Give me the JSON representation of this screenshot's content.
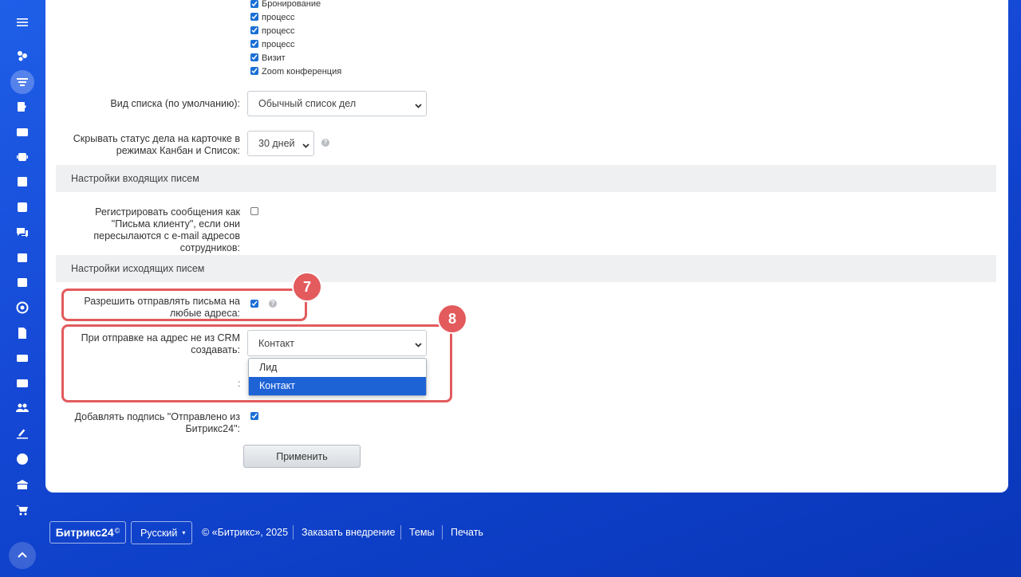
{
  "activity_types": [
    {
      "label": "Бронирование",
      "checked": true
    },
    {
      "label": "процесс",
      "checked": true
    },
    {
      "label": "процесс",
      "checked": true
    },
    {
      "label": "процесс",
      "checked": true
    },
    {
      "label": "Визит",
      "checked": true
    },
    {
      "label": "Zoom конференция",
      "checked": true
    }
  ],
  "list_view": {
    "label": "Вид списка (по умолчанию):",
    "value": "Обычный список дел"
  },
  "hide_status": {
    "label_line1": "Скрывать статус дела на карточке в",
    "label_line2": "режимах Канбан и Список:",
    "value": "30 дней"
  },
  "incoming_section": "Настройки входящих писем",
  "register_messages": {
    "label_line1": "Регистрировать сообщения как",
    "label_line2": "\"Письма клиенту\", если они",
    "label_line3": "пересылаются с e-mail адресов",
    "label_line4": "сотрудников:",
    "checked": false
  },
  "outgoing_section": "Настройки исходящих писем",
  "allow_any": {
    "label_line1": "Разрешить отправлять письма на",
    "label_line2": "любые адреса:",
    "checked": true
  },
  "create_on_send": {
    "label_line1": "При отправке на адрес не из CRM",
    "label_line2": "создавать:",
    "value": "Контакт",
    "options": [
      "Лид",
      "Контакт"
    ],
    "selected_index": 1,
    "stray": ":"
  },
  "add_signature": {
    "label_line1": "Добавлять подпись \"Отправлено из",
    "label_line2": "Битрикс24\":",
    "checked": true
  },
  "apply_label": "Применить",
  "badges": {
    "b7": "7",
    "b8": "8"
  },
  "help_glyph": "?",
  "footer": {
    "logo": "Битрикс24",
    "logo_mark": "©",
    "language": "Русский",
    "copyright": "© «Битрикс», 2025",
    "order": "Заказать внедрение",
    "themes": "Темы",
    "print": "Печать"
  },
  "colors": {
    "accent": "#1a6fd4",
    "highlight": "#e35b5d",
    "background": "#1549d6"
  }
}
